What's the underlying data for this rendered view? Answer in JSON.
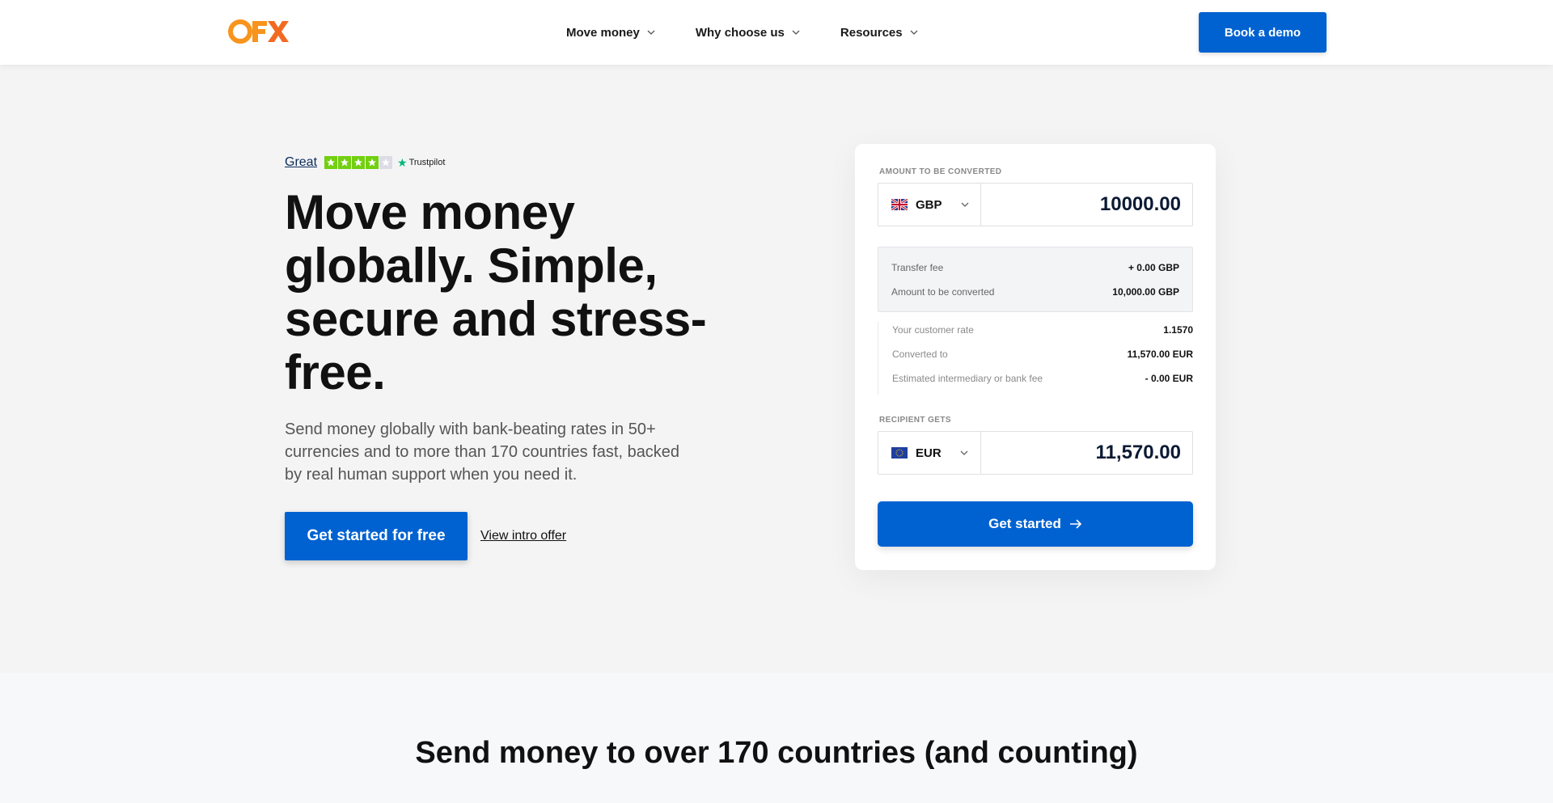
{
  "header": {
    "logo_text": "OFX",
    "nav": [
      {
        "label": "Move money"
      },
      {
        "label": "Why choose us"
      },
      {
        "label": "Resources"
      }
    ],
    "demo_button": "Book a demo"
  },
  "hero": {
    "rating_label": "Great",
    "rating_stars": 4.5,
    "trustpilot": "Trustpilot",
    "headline": "Move money globally. Simple, secure and stress-free.",
    "subtext": "Send money globally with bank-beating rates in 50+ currencies and to more than 170 countries fast, backed by real human support when you need it.",
    "cta_primary": "Get started for free",
    "cta_secondary": "View intro offer"
  },
  "converter": {
    "from_label": "AMOUNT TO BE CONVERTED",
    "from_currency": "GBP",
    "from_amount": "10000.00",
    "fees": [
      {
        "label": "Transfer fee",
        "value": "+ 0.00 GBP"
      },
      {
        "label": "Amount to be converted",
        "value": "10,000.00 GBP"
      }
    ],
    "rates": [
      {
        "label": "Your customer rate",
        "value": "1.1570"
      },
      {
        "label": "Converted to",
        "value": "11,570.00 EUR"
      },
      {
        "label": "Estimated intermediary or bank fee",
        "value": "- 0.00 EUR"
      }
    ],
    "to_label": "RECIPIENT GETS",
    "to_currency": "EUR",
    "to_amount": "11,570.00",
    "cta": "Get started"
  },
  "lower": {
    "title": "Send money to over 170 countries (and counting)"
  },
  "colors": {
    "brand_orange": "#f7941d",
    "primary_blue": "#0062d1",
    "trustpilot_green": "#00b67a",
    "star_green": "#73cf11"
  }
}
